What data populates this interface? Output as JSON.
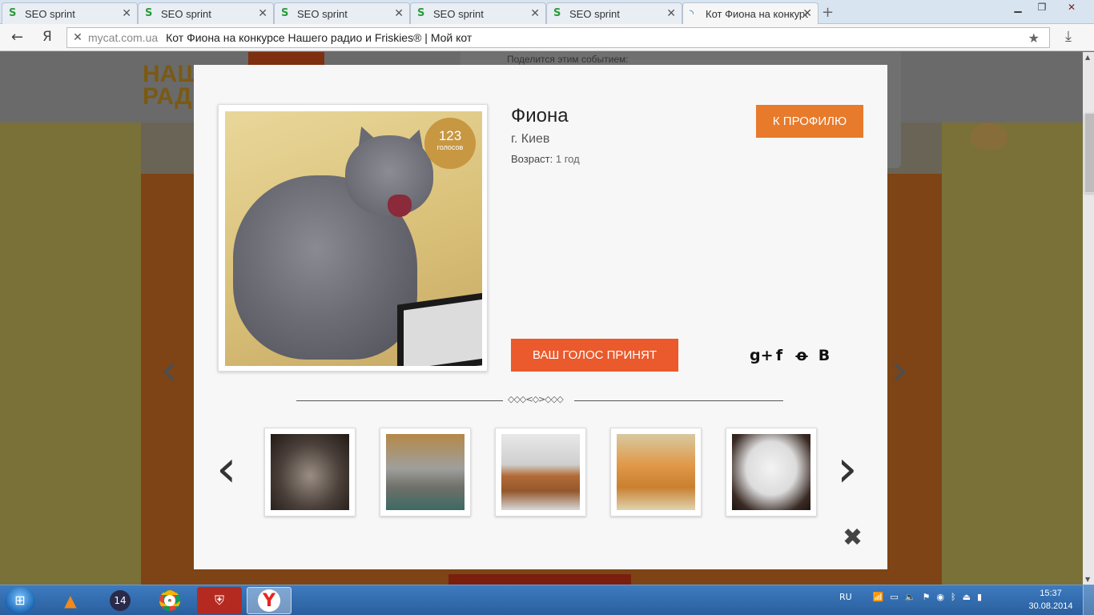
{
  "browser": {
    "tabs": [
      {
        "title": "SEO sprint",
        "favicon": "seo-sprint-icon"
      },
      {
        "title": "SEO sprint",
        "favicon": "seo-sprint-icon"
      },
      {
        "title": "SEO sprint",
        "favicon": "seo-sprint-icon"
      },
      {
        "title": "SEO sprint",
        "favicon": "seo-sprint-icon"
      },
      {
        "title": "SEO sprint",
        "favicon": "seo-sprint-icon"
      },
      {
        "title": "Кот Фиона на конкурсе Нашего радио и Friskies® | Мой кот",
        "favicon": "loading-icon"
      }
    ],
    "active_tab": 5,
    "back_label": "←",
    "yandex_label": "Я",
    "domain": "mycat.com.ua",
    "page_title": "Кот Фиона на конкурсе Нашего радио и Friskies® | Мой кот"
  },
  "background_page": {
    "logo": "НАШ\nРАД",
    "share_text": "Поделится этим событием:"
  },
  "modal": {
    "cat_name": "Фиона",
    "city": "г. Киев",
    "age_label": "Возраст:",
    "age_value": "1 год",
    "votes": "123",
    "votes_label": "голосов",
    "profile_button": "К ПРОФИЛЮ",
    "vote_button": "ВАШ ГОЛОС ПРИНЯТ",
    "social": [
      "g+",
      "f",
      "ok",
      "В"
    ],
    "thumbnails": [
      "cat-photo",
      "cat-photo",
      "cat-photo",
      "cat-photo",
      "cat-photo"
    ],
    "close_icon": "close-icon"
  },
  "taskbar": {
    "apps": [
      "start-icon",
      "vlc-icon",
      "app-icon",
      "chrome-icon",
      "world-of-tanks-icon",
      "yandex-browser-icon"
    ],
    "badge_14": "14",
    "language": "RU",
    "time": "15:37",
    "date": "30.08.2014"
  }
}
